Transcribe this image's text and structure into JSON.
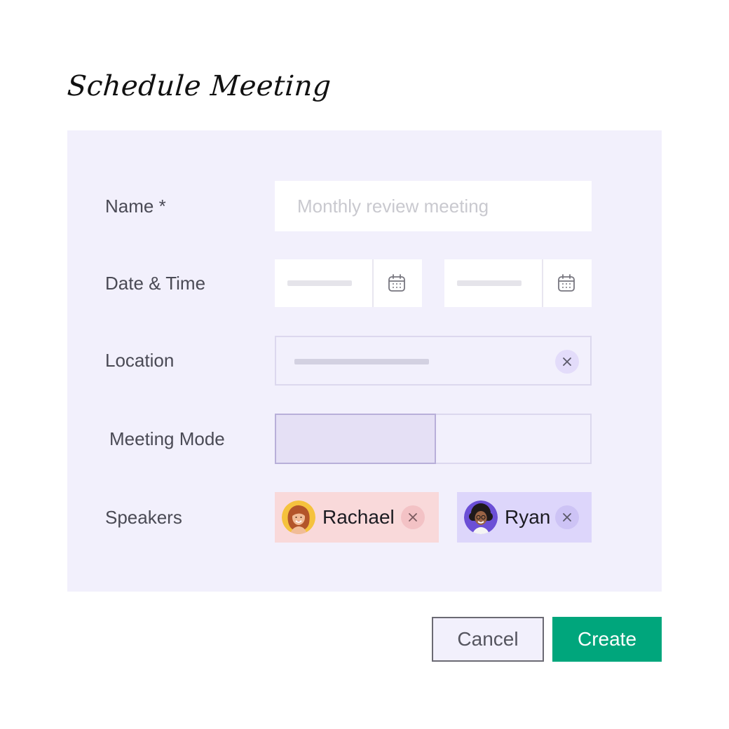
{
  "title": "Schedule Meeting",
  "form": {
    "name_label": "Name *",
    "name_placeholder": "Monthly review meeting",
    "name_value": "",
    "datetime_label": "Date & Time",
    "location_label": "Location",
    "mode_label": "Meeting Mode",
    "speakers_label": "Speakers"
  },
  "speakers": [
    {
      "name": "Rachael",
      "chip_color": "#f9d9da",
      "clear_color": "#f3c2c5"
    },
    {
      "name": "Ryan",
      "chip_color": "#ddd6fb",
      "clear_color": "#cdc3f5"
    }
  ],
  "actions": {
    "cancel_label": "Cancel",
    "create_label": "Create"
  },
  "colors": {
    "panel": "#f2f0fc",
    "accent": "#00a67c"
  },
  "icons": [
    "calendar-icon",
    "close-icon",
    "avatar"
  ]
}
